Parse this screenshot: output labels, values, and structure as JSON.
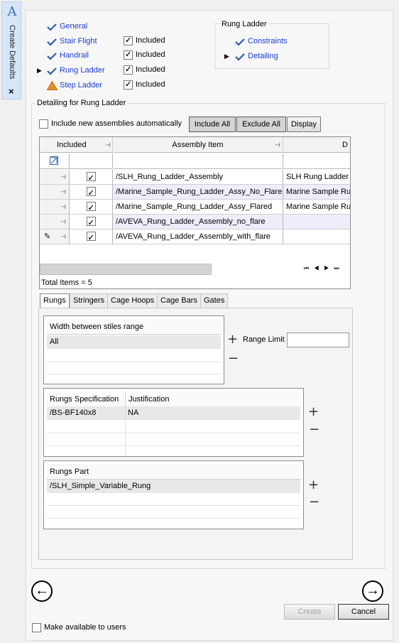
{
  "strip": {
    "title": "Create Defaults",
    "close_icon": "×",
    "logo": "A"
  },
  "nav": [
    {
      "label": "General",
      "icon": "check-icon",
      "included": null,
      "arrow": false
    },
    {
      "label": "Stair Flight",
      "icon": "check-icon",
      "included": "Included",
      "arrow": false
    },
    {
      "label": "Handrail",
      "icon": "check-icon",
      "included": "Included",
      "arrow": false
    },
    {
      "label": "Rung Ladder",
      "icon": "check-icon",
      "included": "Included",
      "arrow": true
    },
    {
      "label": "Step Ladder",
      "icon": "warning-icon",
      "included": "Included",
      "arrow": false
    }
  ],
  "rung_ladder_box": {
    "title": "Rung Ladder",
    "items": [
      {
        "label": "Constraints",
        "arrow": false
      },
      {
        "label": "Detailing",
        "arrow": true
      }
    ]
  },
  "detailing": {
    "title": "Detailing for Rung Ladder",
    "auto_label": "Include new assemblies automatically",
    "include_all": "Include All",
    "exclude_all": "Exclude All",
    "display": "Display"
  },
  "grid": {
    "columns": [
      "Included",
      "Assembly Item",
      "D"
    ],
    "rows": [
      {
        "item": "/SLH_Rung_Ladder_Assembly",
        "desc": "SLH Rung Ladder",
        "checked": true
      },
      {
        "item": "/Marine_Sample_Rung_Ladder_Assy_No_Flare",
        "desc": "Marine Sample Ru",
        "checked": true
      },
      {
        "item": "/Marine_Sample_Rung_Ladder_Assy_Flared",
        "desc": "Marine Sample Ru",
        "checked": true
      },
      {
        "item": "/AVEVA_Rung_Ladder_Assembly_no_flare",
        "desc": "",
        "checked": true
      },
      {
        "item": "/AVEVA_Rung_Ladder_Assembly_with_flare",
        "desc": "",
        "checked": true
      }
    ],
    "total": "Total Items = 5"
  },
  "tabs": [
    "Rungs",
    "Stringers",
    "Cage Hoops",
    "Cage Bars",
    "Gates"
  ],
  "width_table": {
    "header": "Width between stiles range",
    "value": "All",
    "range_limit_label": "Range Limit",
    "range_limit_value": ""
  },
  "spec_table": {
    "col1": "Rungs Specification",
    "col2": "Justification",
    "spec": "/BS-BF140x8",
    "just": "NA"
  },
  "part_table": {
    "header": "Rungs Part",
    "value": "/SLH_Simple_Variable_Rung"
  },
  "footer": {
    "create": "Create",
    "cancel": "Cancel",
    "make_available": "Make available to users",
    "back": "←",
    "next": "→"
  },
  "plus": "+",
  "minus": "−"
}
